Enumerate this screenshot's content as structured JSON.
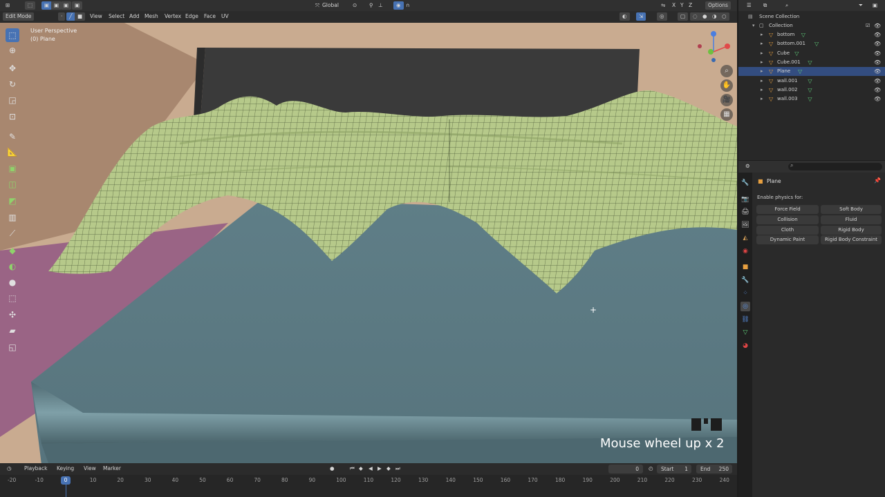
{
  "header": {
    "mode": "Edit Mode",
    "menus": [
      "View",
      "Select",
      "Add",
      "Mesh",
      "Vertex",
      "Edge",
      "Face",
      "UV"
    ],
    "transform_orientation": "Global",
    "options": "Options"
  },
  "viewport": {
    "perspective_label": "User Perspective",
    "object_label": "(0) Plane",
    "keypress_text": "Mouse wheel up x 2"
  },
  "outliner": {
    "scene_collection": "Scene Collection",
    "collection": "Collection",
    "items": [
      {
        "name": "bottom",
        "selected": false
      },
      {
        "name": "bottom.001",
        "selected": false
      },
      {
        "name": "Cube",
        "selected": false
      },
      {
        "name": "Cube.001",
        "selected": false
      },
      {
        "name": "Plane",
        "selected": true
      },
      {
        "name": "wall.001",
        "selected": false
      },
      {
        "name": "wall.002",
        "selected": false
      },
      {
        "name": "wall.003",
        "selected": false
      }
    ]
  },
  "properties": {
    "object_name": "Plane",
    "enable_physics_label": "Enable physics for:",
    "buttons": {
      "force_field": "Force Field",
      "soft_body": "Soft Body",
      "collision": "Collision",
      "fluid": "Fluid",
      "cloth": "Cloth",
      "rigid_body": "Rigid Body",
      "dynamic_paint": "Dynamic Paint",
      "rigid_body_constraint": "Rigid Body Constraint"
    }
  },
  "timeline": {
    "menus": [
      "Playback",
      "Keying",
      "View",
      "Marker"
    ],
    "current_frame": "0",
    "start_label": "Start",
    "start_value": "1",
    "end_label": "End",
    "end_value": "250",
    "ticks": [
      "-20",
      "-10",
      "0",
      "10",
      "20",
      "30",
      "40",
      "50",
      "60",
      "70",
      "80",
      "90",
      "100",
      "110",
      "120",
      "130",
      "140",
      "150",
      "160",
      "170",
      "180",
      "190",
      "200",
      "210",
      "220",
      "230",
      "240"
    ]
  },
  "colors": {
    "accent_blue": "#4772b3",
    "selection_row": "#334d80",
    "cloth_green": "#b6c98a",
    "table_slate": "#5e7d86",
    "wall_tan": "#c9ab90",
    "floor_magenta": "#9a6485"
  }
}
